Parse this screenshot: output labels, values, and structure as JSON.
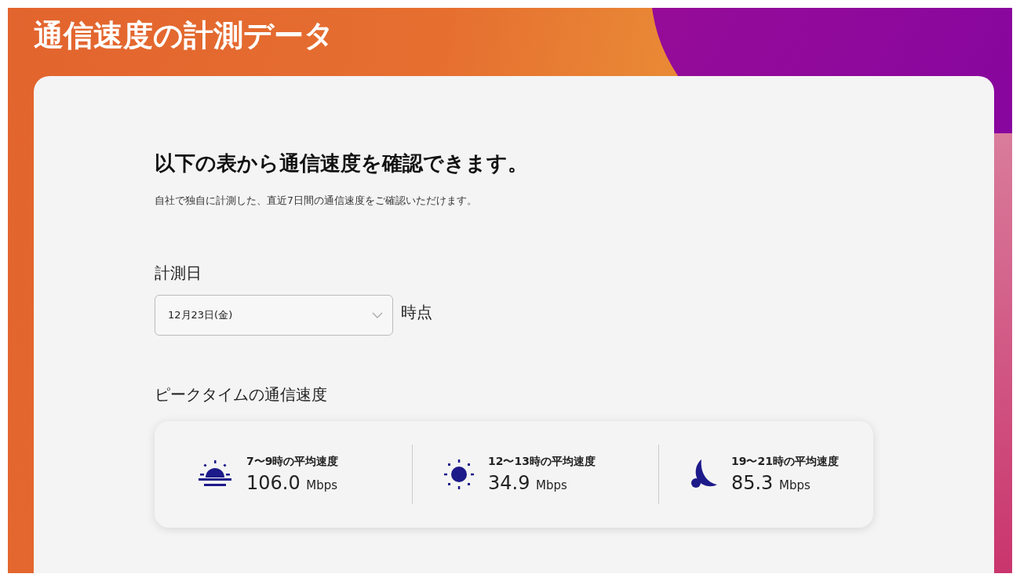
{
  "page_title": "通信速度の計測データ",
  "heading": "以下の表から通信速度を確認できます。",
  "description": "自社で独自に計測した、直近7日間の通信速度をご確認いただけます。",
  "date_label": "計測日",
  "date_select": {
    "value": "12月23日(金)"
  },
  "date_suffix": "時点",
  "peak_title": "ピークタイムの通信速度",
  "peak_speeds": [
    {
      "kind": "sunrise",
      "label": "7〜9時の平均速度",
      "value": "106.0",
      "unit": "Mbps"
    },
    {
      "kind": "sun",
      "label": "12〜13時の平均速度",
      "value": "34.9",
      "unit": "Mbps"
    },
    {
      "kind": "moon",
      "label": "19〜21時の平均速度",
      "value": "85.3",
      "unit": "Mbps"
    }
  ]
}
